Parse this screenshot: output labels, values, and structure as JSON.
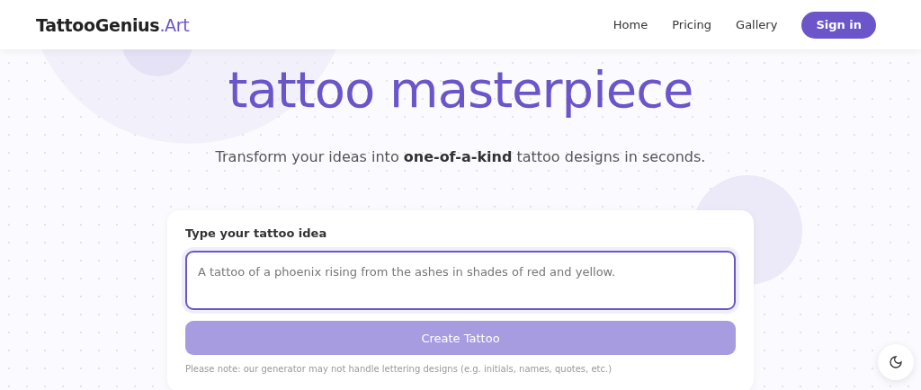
{
  "header": {
    "logo": {
      "main": "TattooGenius",
      "suffix": ".Art"
    },
    "nav": [
      {
        "label": "Home"
      },
      {
        "label": "Pricing"
      },
      {
        "label": "Gallery"
      }
    ],
    "sign_in": "Sign in"
  },
  "hero": {
    "title": "tattoo masterpiece",
    "subtitle": "Transform your ideas into **one-of-a-kind** tattoo designs in seconds."
  },
  "form": {
    "label": "Type your tattoo idea",
    "placeholder": "A tattoo of a phoenix rising from the ashes in shades of red and yellow.",
    "button": {
      "label": "Create Tattoo",
      "disabled": true
    },
    "note": "Please note: our generator may not handle lettering designs (e.g. initials, names, quotes, etc.)"
  }
}
